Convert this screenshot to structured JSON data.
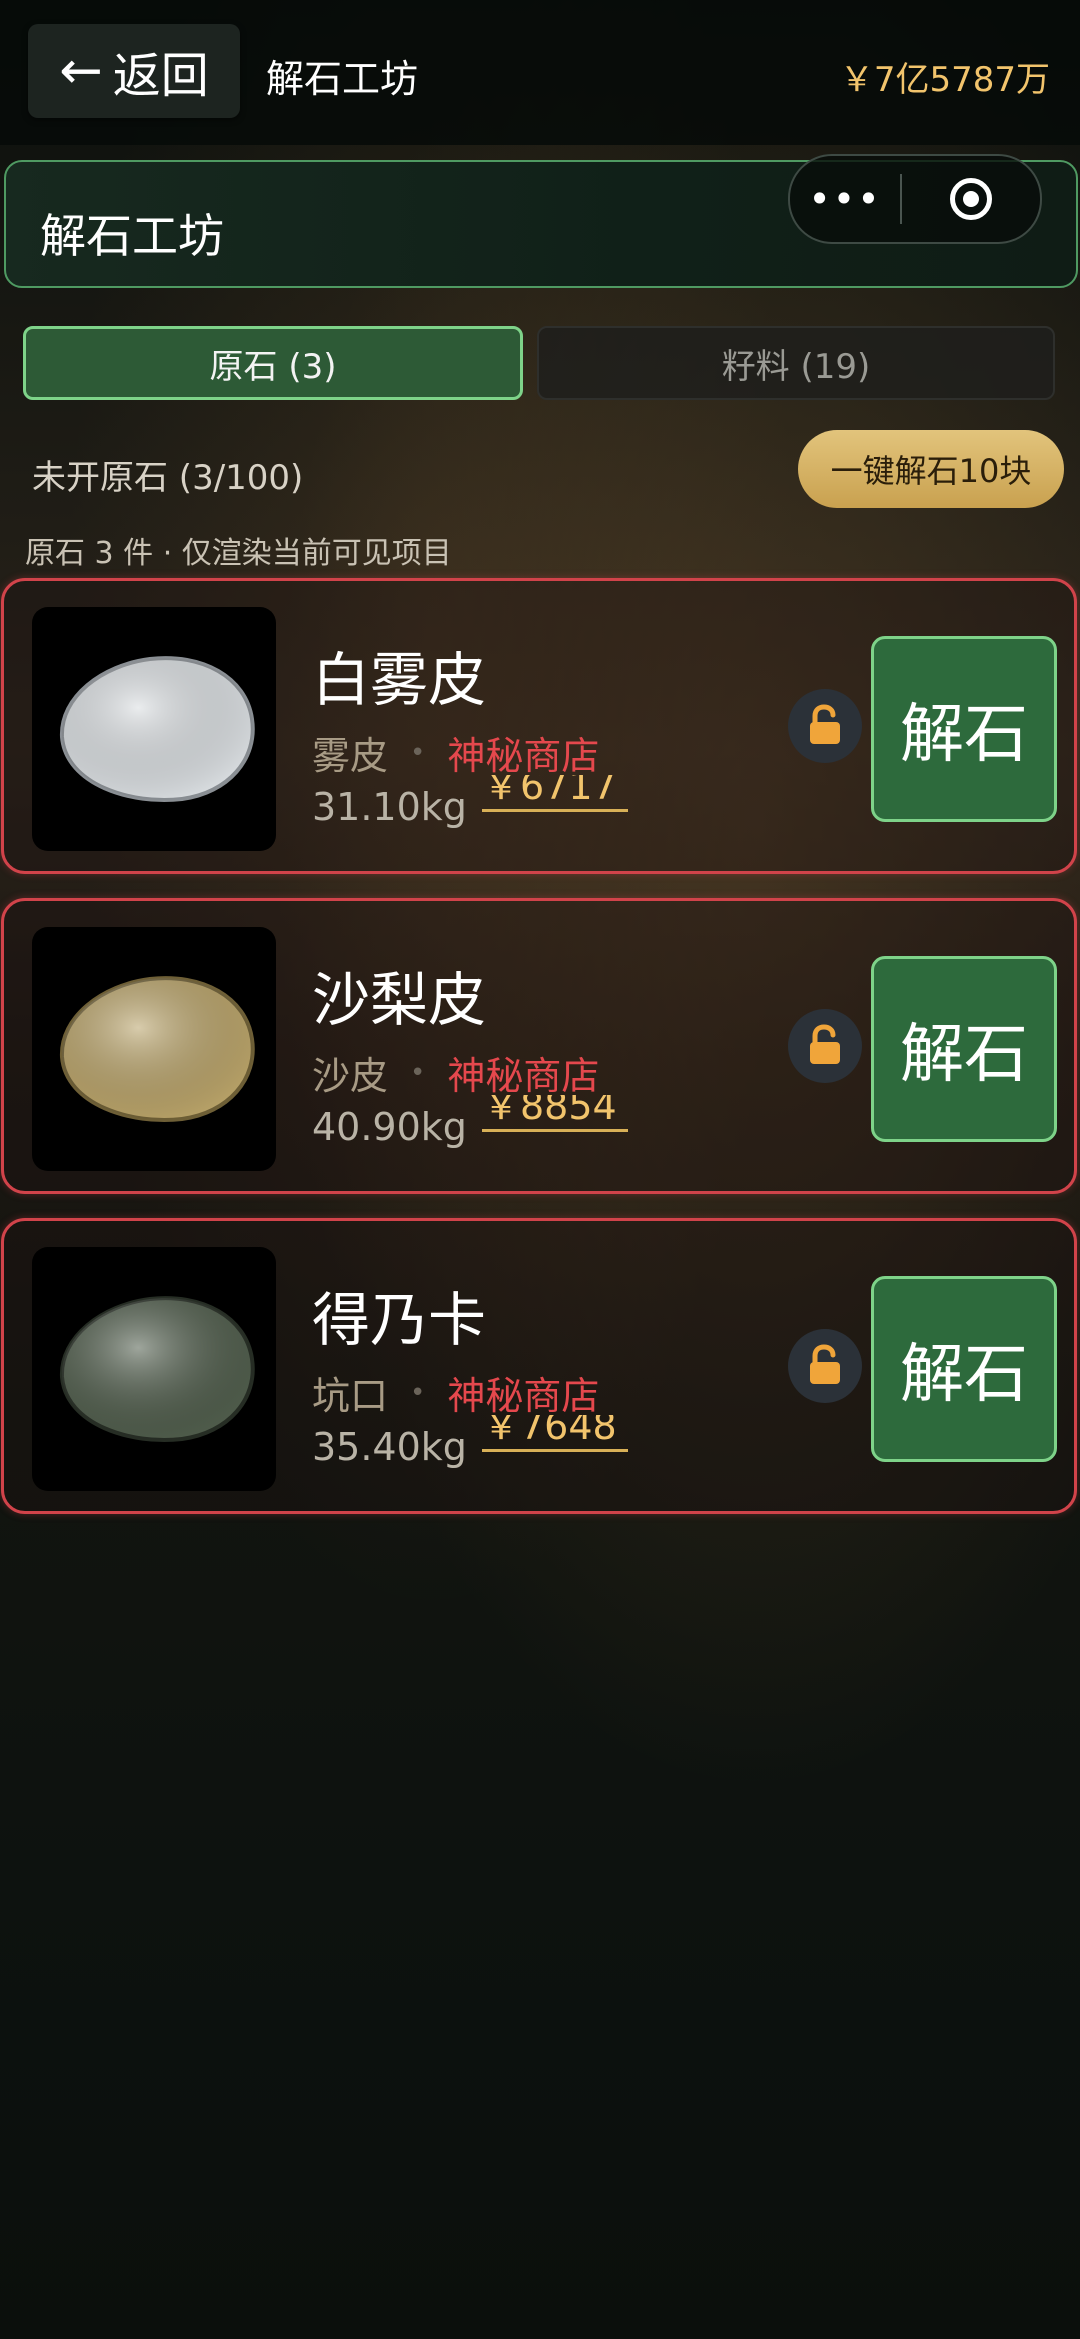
{
  "topbar": {
    "back_label": "返回",
    "title": "解石工坊",
    "balance": "￥7亿5787万"
  },
  "header": {
    "title": "解石工坊"
  },
  "tabs": [
    {
      "label": "原石 (3)",
      "active": true
    },
    {
      "label": "籽料 (19)",
      "active": false
    }
  ],
  "status": {
    "unopened": "未开原石 (3/100)",
    "batch_label": "一键解石10块",
    "notice": "原石 3 件 · 仅渲染当前可见项目"
  },
  "items": [
    {
      "name": "白雾皮",
      "type": "雾皮",
      "shop": "神秘商店",
      "weight": "31.10kg",
      "price": "￥6717",
      "open_label": "解石",
      "stone_color": "#d9dde0",
      "stone_shadow": "#8a8f94"
    },
    {
      "name": "沙梨皮",
      "type": "沙皮",
      "shop": "神秘商店",
      "weight": "40.90kg",
      "price": "￥8854",
      "open_label": "解石",
      "stone_color": "#b8a268",
      "stone_shadow": "#6e5f36"
    },
    {
      "name": "得乃卡",
      "type": "坑口",
      "shop": "神秘商店",
      "weight": "35.40kg",
      "price": "￥7648",
      "open_label": "解石",
      "stone_color": "#4f5c4b",
      "stone_shadow": "#262d24"
    }
  ],
  "colors": {
    "accent_green": "#2d6a3c",
    "gold": "#f2c46c",
    "alert_red": "#d1434a"
  },
  "icons": {
    "back": "arrow-left-icon",
    "menu": "more-dots-icon",
    "capture": "target-icon",
    "lock": "unlock-icon"
  }
}
